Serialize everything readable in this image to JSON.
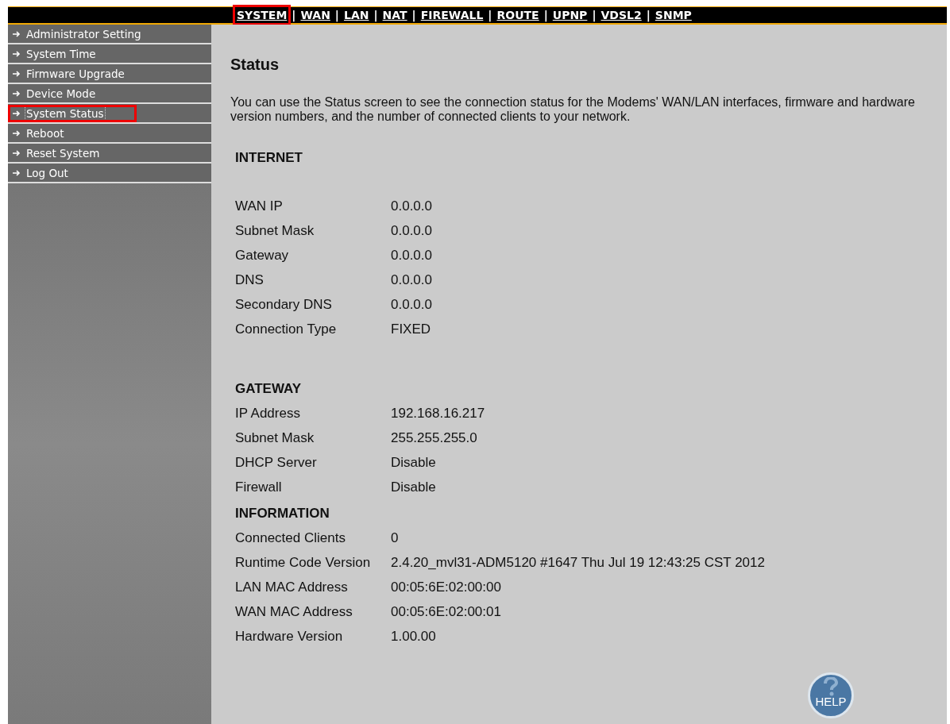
{
  "nav": {
    "separator": "|",
    "tabs": [
      {
        "label": "SYSTEM",
        "highlighted": true
      },
      {
        "label": "WAN",
        "highlighted": false
      },
      {
        "label": "LAN",
        "highlighted": false
      },
      {
        "label": "NAT",
        "highlighted": false
      },
      {
        "label": "FIREWALL",
        "highlighted": false
      },
      {
        "label": "ROUTE",
        "highlighted": false
      },
      {
        "label": "UPNP",
        "highlighted": false
      },
      {
        "label": "VDSL2",
        "highlighted": false
      },
      {
        "label": "SNMP",
        "highlighted": false
      }
    ]
  },
  "sidebar": {
    "items": [
      {
        "label": "Administrator Setting",
        "selected": false,
        "highlighted": false
      },
      {
        "label": "System Time",
        "selected": false,
        "highlighted": false
      },
      {
        "label": "Firmware Upgrade",
        "selected": false,
        "highlighted": false
      },
      {
        "label": "Device Mode",
        "selected": false,
        "highlighted": false
      },
      {
        "label": "System Status",
        "selected": true,
        "highlighted": true
      },
      {
        "label": "Reboot",
        "selected": false,
        "highlighted": false
      },
      {
        "label": "Reset System",
        "selected": false,
        "highlighted": false
      },
      {
        "label": "Log Out",
        "selected": false,
        "highlighted": false
      }
    ]
  },
  "page": {
    "title": "Status",
    "description": "You can use the Status screen to see the connection status for the Modems' WAN/LAN interfaces, firmware and hardware version numbers, and the number of connected clients to your network.",
    "sections": [
      {
        "heading": "INTERNET",
        "rows": [
          {
            "label": "WAN IP",
            "value": "0.0.0.0"
          },
          {
            "label": "Subnet Mask",
            "value": "0.0.0.0"
          },
          {
            "label": "Gateway",
            "value": "0.0.0.0"
          },
          {
            "label": "DNS",
            "value": "0.0.0.0"
          },
          {
            "label": "Secondary DNS",
            "value": "0.0.0.0"
          },
          {
            "label": "Connection Type",
            "value": "FIXED"
          }
        ]
      },
      {
        "heading": "GATEWAY",
        "rows": [
          {
            "label": "IP Address",
            "value": "192.168.16.217"
          },
          {
            "label": "Subnet Mask",
            "value": "255.255.255.0"
          },
          {
            "label": "DHCP Server",
            "value": "Disable"
          },
          {
            "label": "Firewall",
            "value": "Disable"
          }
        ]
      },
      {
        "heading": "INFORMATION",
        "rows": [
          {
            "label": "Connected Clients",
            "value": "0"
          },
          {
            "label": "Runtime Code Version",
            "value": "2.4.20_mvl31-ADM5120 #1647 Thu Jul 19 12:43:25 CST 2012"
          },
          {
            "label": "LAN MAC Address",
            "value": "00:05:6E:02:00:00"
          },
          {
            "label": "WAN MAC Address",
            "value": "00:05:6E:02:00:01"
          },
          {
            "label": "Hardware Version",
            "value": "1.00.00"
          }
        ]
      }
    ]
  },
  "help_button": {
    "label": "HELP"
  }
}
